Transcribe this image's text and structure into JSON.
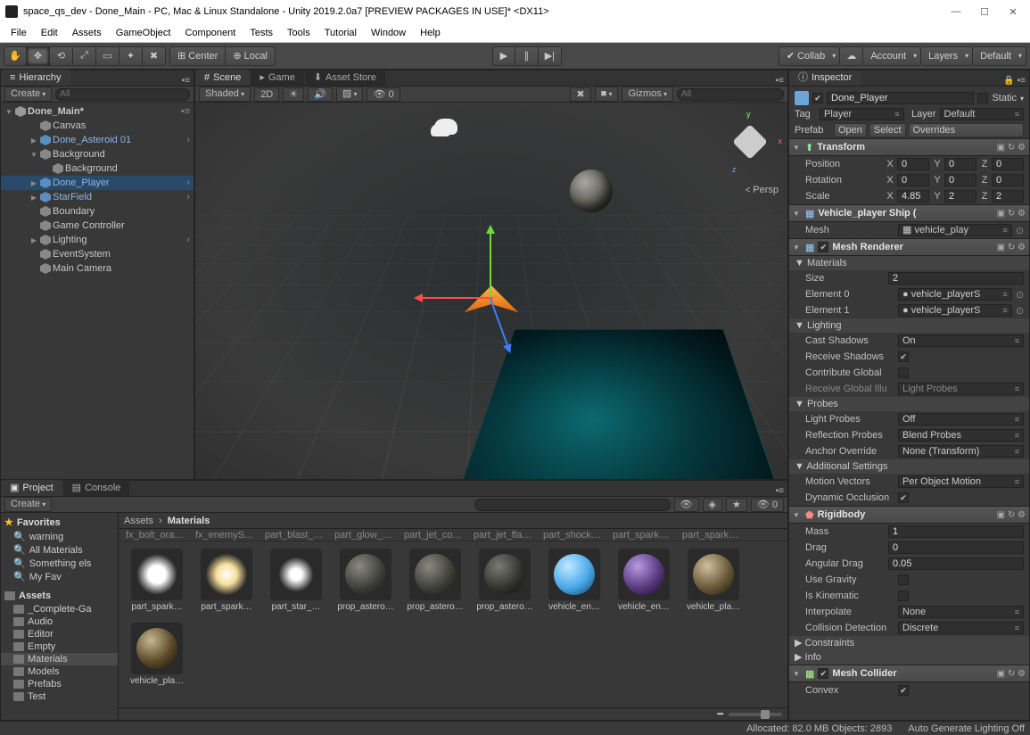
{
  "window": {
    "title": "space_qs_dev - Done_Main - PC, Mac & Linux Standalone - Unity 2019.2.0a7 [PREVIEW PACKAGES IN USE]* <DX11>"
  },
  "menus": [
    "File",
    "Edit",
    "Assets",
    "GameObject",
    "Component",
    "Tests",
    "Tools",
    "Tutorial",
    "Window",
    "Help"
  ],
  "toolbar": {
    "pivot_center": "Center",
    "pivot_local": "Local",
    "collab": "Collab",
    "account": "Account",
    "layers": "Layers",
    "layout": "Default"
  },
  "hierarchy": {
    "tab": "Hierarchy",
    "create": "Create",
    "search_placeholder": "All",
    "scene": "Done_Main*",
    "items": [
      {
        "name": "Canvas",
        "indent": 1,
        "prefab": false
      },
      {
        "name": "Done_Asteroid 01",
        "indent": 1,
        "prefab": true,
        "expand": true
      },
      {
        "name": "Background",
        "indent": 1,
        "prefab": false,
        "fold": "▼"
      },
      {
        "name": "Background",
        "indent": 2,
        "prefab": false
      },
      {
        "name": "Done_Player",
        "indent": 1,
        "prefab": true,
        "sel": true,
        "expand": true
      },
      {
        "name": "StarField",
        "indent": 1,
        "prefab": true,
        "expand": true
      },
      {
        "name": "Boundary",
        "indent": 1,
        "prefab": false
      },
      {
        "name": "Game Controller",
        "indent": 1,
        "prefab": false
      },
      {
        "name": "Lighting",
        "indent": 1,
        "prefab": false,
        "expand": true
      },
      {
        "name": "EventSystem",
        "indent": 1,
        "prefab": false
      },
      {
        "name": "Main Camera",
        "indent": 1,
        "prefab": false
      }
    ]
  },
  "scene": {
    "tabs": [
      "Scene",
      "Game",
      "Asset Store"
    ],
    "shading": "Shaded",
    "mode2d": "2D",
    "gizmos": "Gizmos",
    "search_placeholder": "All",
    "persp": "Persp",
    "axis": {
      "x": "x",
      "y": "y",
      "z": "z"
    }
  },
  "project": {
    "tabs": [
      "Project",
      "Console"
    ],
    "create": "Create",
    "breadcrumb_root": "Assets",
    "breadcrumb_leaf": "Materials",
    "count_badge": "0",
    "favorites_label": "Favorites",
    "assets_label": "Assets",
    "favorites": [
      "warning",
      "All Materials",
      "Something els",
      "My Fav"
    ],
    "folders": [
      "_Complete-Ga",
      "Audio",
      "Editor",
      "Empty",
      "Materials",
      "Models",
      "Prefabs",
      "Test"
    ],
    "folder_sel": "Materials",
    "top_row": [
      "fx_bolt_ora…",
      "fx_enemySh…",
      "part_blast_…",
      "part_glow_…",
      "part_jet_co…",
      "part_jet_fla…",
      "part_shock…",
      "part_spark…",
      "part_spark…"
    ],
    "assets": [
      {
        "name": "part_spark…",
        "col": "radial-gradient(ellipse at 50% 50%, #fff, #fff 30%, rgba(255,255,255,0) 70%)"
      },
      {
        "name": "part_spark…",
        "col": "radial-gradient(ellipse at 50% 50%, #fff, #f7df9a 35%, rgba(0,0,0,0) 72%)"
      },
      {
        "name": "part_star_…",
        "col": "radial-gradient(circle, #fff, #fff 20%, rgba(255,255,255,0) 60%)"
      },
      {
        "name": "prop_astero…",
        "col": "radial-gradient(circle at 35% 30%, #8a8a82, #3a3a34 60%, #15140f)"
      },
      {
        "name": "prop_astero…",
        "col": "radial-gradient(circle at 35% 30%, #8a8a82, #3a3a34 60%, #15140f)"
      },
      {
        "name": "prop_astero…",
        "col": "radial-gradient(circle at 35% 30%, #7b7b74, #2f2f2a 60%, #101009)"
      },
      {
        "name": "vehicle_en…",
        "col": "radial-gradient(circle at 35% 30%, #bfe9ff, #4aa8e8 55%, #0a3a60)"
      },
      {
        "name": "vehicle_en…",
        "col": "radial-gradient(circle at 35% 30%, #b89ae0, #5a3a80 55%, #150a25)"
      },
      {
        "name": "vehicle_pla…",
        "col": "radial-gradient(circle at 35% 30%, #d0c0a0, #6a5a3a 55%, #1a1408)"
      },
      {
        "name": "vehicle_pla…",
        "col": "radial-gradient(circle at 35% 30%, #c8b890, #5a4a2a 55%, #151005)"
      }
    ]
  },
  "inspector": {
    "tab": "Inspector",
    "name": "Done_Player",
    "static": "Static",
    "tag_label": "Tag",
    "tag": "Player",
    "layer_label": "Layer",
    "layer": "Default",
    "prefab_label": "Prefab",
    "open": "Open",
    "select": "Select",
    "overrides": "Overrides",
    "transform": {
      "title": "Transform",
      "position": "Position",
      "rotation": "Rotation",
      "scale": "Scale",
      "px": "0",
      "py": "0",
      "pz": "0",
      "rx": "0",
      "ry": "0",
      "rz": "0",
      "sx": "4.85",
      "sy": "2",
      "sz": "2"
    },
    "meshfilter": {
      "title": "Vehicle_player Ship (",
      "mesh_label": "Mesh",
      "mesh": "vehicle_play"
    },
    "renderer": {
      "title": "Mesh Renderer",
      "materials": "Materials",
      "size_label": "Size",
      "size": "2",
      "el0_label": "Element 0",
      "el0": "vehicle_playerS",
      "el1_label": "Element 1",
      "el1": "vehicle_playerS",
      "lighting": "Lighting",
      "cast_label": "Cast Shadows",
      "cast": "On",
      "recv_label": "Receive Shadows",
      "contrib_label": "Contribute Global",
      "recv_gi_label": "Receive Global Illu",
      "recv_gi": "Light Probes",
      "probes": "Probes",
      "light_probes_label": "Light Probes",
      "light_probes": "Off",
      "refl_label": "Reflection Probes",
      "refl": "Blend Probes",
      "anchor_label": "Anchor Override",
      "anchor": "None (Transform)",
      "additional": "Additional Settings",
      "motion_label": "Motion Vectors",
      "motion": "Per Object Motion",
      "dynocc_label": "Dynamic Occlusion"
    },
    "rigidbody": {
      "title": "Rigidbody",
      "mass_label": "Mass",
      "mass": "1",
      "drag_label": "Drag",
      "drag": "0",
      "angdrag_label": "Angular Drag",
      "angdrag": "0.05",
      "grav_label": "Use Gravity",
      "kin_label": "Is Kinematic",
      "interp_label": "Interpolate",
      "interp": "None",
      "coll_label": "Collision Detection",
      "coll": "Discrete",
      "constraints": "Constraints",
      "info": "Info"
    },
    "meshcollider": {
      "title": "Mesh Collider",
      "convex": "Convex"
    }
  },
  "status": {
    "alloc": "Allocated: 82.0 MB Objects: 2893",
    "lighting": "Auto Generate Lighting Off"
  }
}
